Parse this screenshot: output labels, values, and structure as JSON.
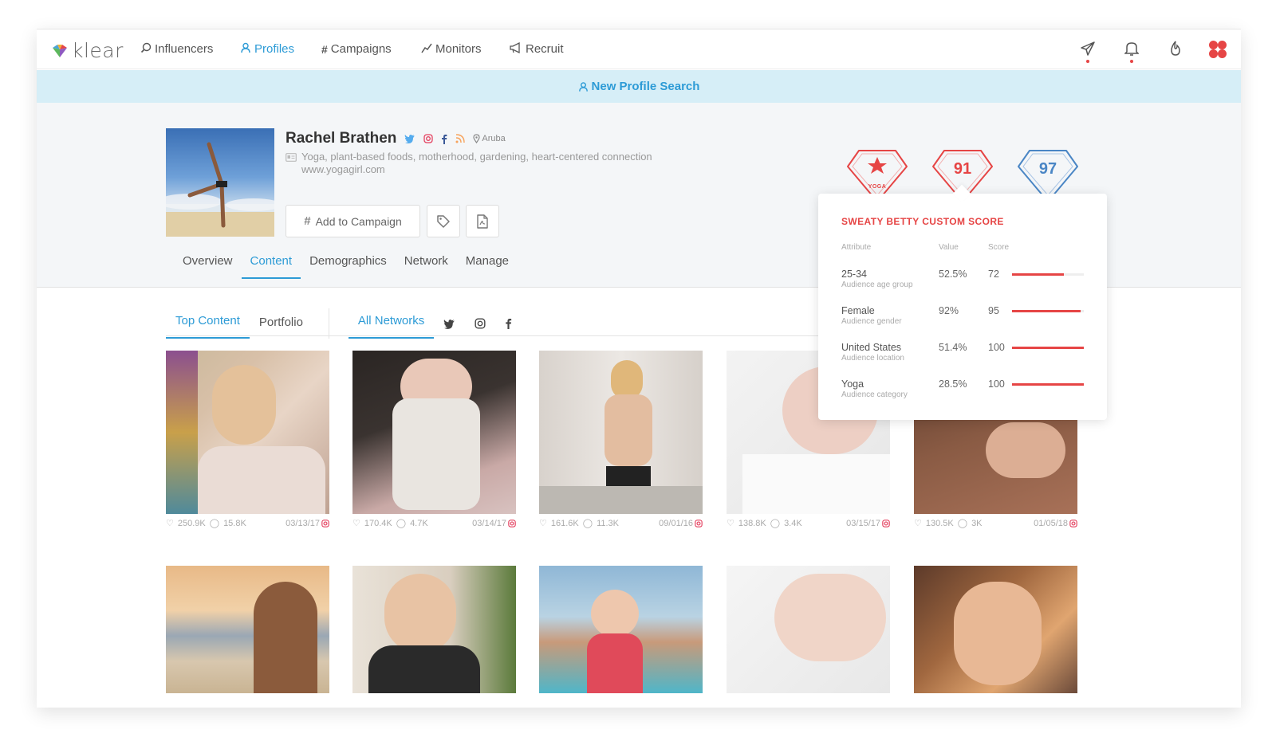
{
  "app": {
    "logo_text": "klear"
  },
  "nav": {
    "items": [
      {
        "label": "Influencers"
      },
      {
        "label": "Profiles"
      },
      {
        "label": "Campaigns"
      },
      {
        "label": "Monitors"
      },
      {
        "label": "Recruit"
      }
    ]
  },
  "banner": {
    "label": "New Profile Search"
  },
  "profile": {
    "name": "Rachel Brathen",
    "location": "Aruba",
    "bio": "Yoga, plant-based foods, motherhood, gardening, heart-centered connection",
    "website": "www.yogagirl.com",
    "add_campaign_label": "Add to Campaign",
    "tabs": [
      {
        "label": "Overview"
      },
      {
        "label": "Content"
      },
      {
        "label": "Demographics"
      },
      {
        "label": "Network"
      },
      {
        "label": "Manage"
      }
    ]
  },
  "badges": [
    {
      "text": "YOGA",
      "color": "#e64545"
    },
    {
      "text": "91",
      "color": "#e64545"
    },
    {
      "text": "97",
      "color": "#4a86c5"
    }
  ],
  "content_tabs": {
    "top_content": "Top Content",
    "portfolio": "Portfolio",
    "all_networks": "All Networks"
  },
  "posts": [
    {
      "likes": "250.9K",
      "comments": "15.8K",
      "date": "03/13/17"
    },
    {
      "likes": "170.4K",
      "comments": "4.7K",
      "date": "03/14/17"
    },
    {
      "likes": "161.6K",
      "comments": "11.3K",
      "date": "09/01/16"
    },
    {
      "likes": "138.8K",
      "comments": "3.4K",
      "date": "03/15/17"
    },
    {
      "likes": "130.5K",
      "comments": "3K",
      "date": "01/05/18"
    }
  ],
  "custom_score": {
    "title": "SWEATY BETTY CUSTOM SCORE",
    "headers": {
      "attribute": "Attribute",
      "value": "Value",
      "score": "Score"
    },
    "rows": [
      {
        "attribute": "25-34",
        "sub": "Audience age group",
        "value": "52.5%",
        "score": "72",
        "score_num": 72
      },
      {
        "attribute": "Female",
        "sub": "Audience gender",
        "value": "92%",
        "score": "95",
        "score_num": 95
      },
      {
        "attribute": "United States",
        "sub": "Audience location",
        "value": "51.4%",
        "score": "100",
        "score_num": 100
      },
      {
        "attribute": "Yoga",
        "sub": "Audience category",
        "value": "28.5%",
        "score": "100",
        "score_num": 100
      }
    ]
  },
  "colors": {
    "accent": "#2d9bd6",
    "red": "#e64545",
    "blue_badge": "#4a86c5"
  }
}
